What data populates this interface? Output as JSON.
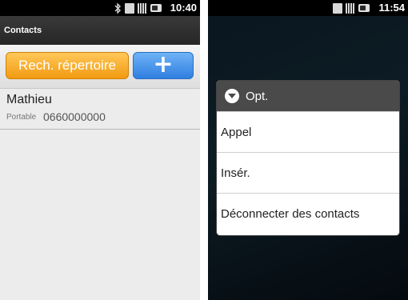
{
  "left_screen": {
    "status_bar": {
      "time": "10:40",
      "icons": [
        "bluetooth-icon",
        "phone-vibrate-icon",
        "signal-icon",
        "battery-icon"
      ]
    },
    "title": "Contacts",
    "search_button": "Rech. répertoire",
    "add_button": "+",
    "contacts": [
      {
        "name": "Mathieu",
        "type": "Portable",
        "number": "0660000000"
      }
    ]
  },
  "right_screen": {
    "status_bar": {
      "time": "11:54",
      "icons": [
        "phone-vibrate-icon",
        "signal-icon",
        "battery-icon"
      ]
    },
    "dialog": {
      "title": "Opt.",
      "items": [
        "Appel",
        "Insér.",
        "Déconnecter des contacts"
      ]
    }
  },
  "colors": {
    "accent_orange": "#f29a10",
    "accent_blue": "#2f7fe0",
    "title_bar": "#2f2f2f",
    "dialog_head": "#4a4a4a"
  }
}
